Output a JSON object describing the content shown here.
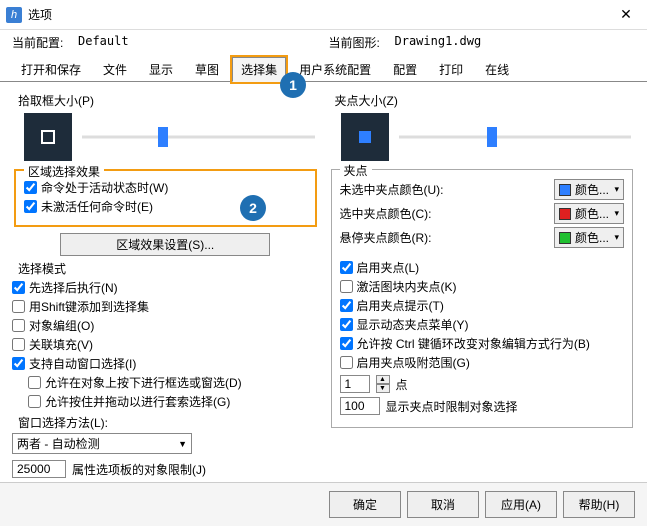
{
  "window": {
    "title": "选项",
    "close_icon": "✕"
  },
  "header": {
    "config_label": "当前配置:",
    "config_value": "Default",
    "drawing_label": "当前图形:",
    "drawing_value": "Drawing1.dwg"
  },
  "tabs": {
    "items": [
      {
        "label": "打开和保存"
      },
      {
        "label": "文件"
      },
      {
        "label": "显示"
      },
      {
        "label": "草图"
      },
      {
        "label": "选择集"
      },
      {
        "label": "用户系统配置"
      },
      {
        "label": "配置"
      },
      {
        "label": "打印"
      },
      {
        "label": "在线"
      }
    ],
    "active_index": 4,
    "highlighted_index": 4
  },
  "badges": {
    "one": "1",
    "two": "2"
  },
  "left": {
    "pick_title": "拾取框大小(P)",
    "region_effect": {
      "title": "区域选择效果",
      "cmd_active": {
        "label": "命令处于活动状态时(W)",
        "checked": true
      },
      "no_cmd": {
        "label": "未激活任何命令时(E)",
        "checked": true
      },
      "settings_btn": "区域效果设置(S)..."
    },
    "select_mode": {
      "title": "选择模式",
      "preselect": {
        "label": "先选择后执行(N)",
        "checked": true
      },
      "shift_add": {
        "label": "用Shift键添加到选择集",
        "checked": false
      },
      "groups": {
        "label": "对象编组(O)",
        "checked": false
      },
      "assoc_hatch": {
        "label": "关联填充(V)",
        "checked": false
      },
      "auto_window": {
        "label": "支持自动窗口选择(I)",
        "checked": true
      },
      "allow_press_drag_window": {
        "label": "允许在对象上按下进行框选或窗选(D)",
        "checked": false
      },
      "allow_press_drag_lasso": {
        "label": "允许按住并拖动以进行套索选择(G)",
        "checked": false
      },
      "window_method_label": "窗口选择方法(L):",
      "window_method_value": "两者 - 自动检测",
      "limit_value": "25000",
      "limit_label": "属性选项板的对象限制(J)"
    }
  },
  "right": {
    "grip_size_title": "夹点大小(Z)",
    "grip": {
      "title": "夹点",
      "unselected": {
        "label": "未选中夹点颜色(U):",
        "btn": "颜色...",
        "color": "#2e7fff"
      },
      "selected": {
        "label": "选中夹点颜色(C):",
        "btn": "颜色...",
        "color": "#e02020"
      },
      "hover": {
        "label": "悬停夹点颜色(R):",
        "btn": "颜色...",
        "color": "#20c030"
      },
      "enable_grips": {
        "label": "启用夹点(L)",
        "checked": true
      },
      "in_block": {
        "label": "激活图块内夹点(K)",
        "checked": false
      },
      "grip_tips": {
        "label": "启用夹点提示(T)",
        "checked": true
      },
      "dyn_menu": {
        "label": "显示动态夹点菜单(Y)",
        "checked": true
      },
      "ctrl_cycle": {
        "label": "允许按 Ctrl 键循环改变对象编辑方式行为(B)",
        "checked": true
      },
      "snap_range": {
        "label": "启用夹点吸附范围(G)",
        "checked": false
      },
      "snap_px_value": "1",
      "snap_px_unit": "点",
      "limit_value": "100",
      "limit_label": "显示夹点时限制对象选择"
    }
  },
  "footer": {
    "ok": "确定",
    "cancel": "取消",
    "apply": "应用(A)",
    "help": "帮助(H)"
  }
}
